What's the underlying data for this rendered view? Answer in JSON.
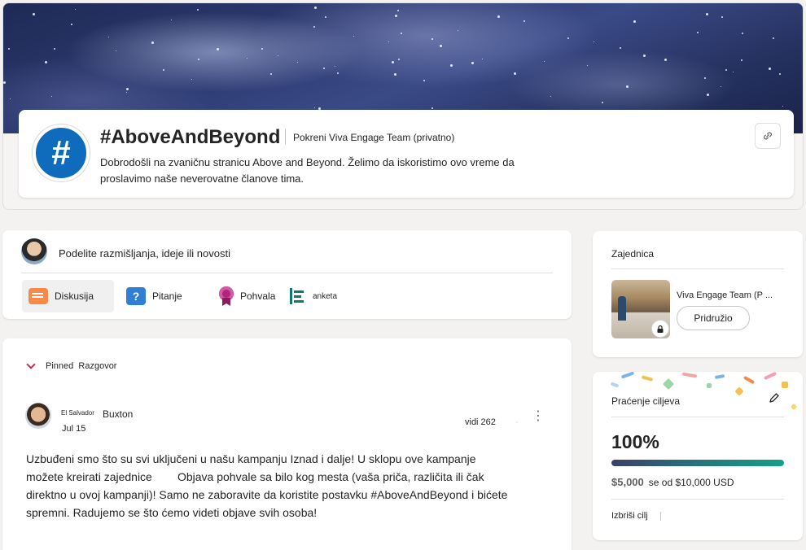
{
  "group": {
    "title": "#AboveAndBeyond",
    "subtitle": "Pokreni Viva Engage Team (privatno)",
    "description": "Dobrodošli na zvaničnu stranicu Above and Beyond. Želimo da iskoristimo ovo vreme da proslavimo naše neverovatne članove tima.",
    "avatar_glyph": "#",
    "link_icon": "link-icon",
    "accent": "#0f6cbd"
  },
  "composer": {
    "prompt": "Podelite razmišljanja, ideje ili novosti",
    "types": [
      {
        "label": "Diskusija",
        "icon": "discussion-icon"
      },
      {
        "label": "Pitanje",
        "icon": "question-icon"
      },
      {
        "label": "Pohvala",
        "icon": "praise-icon"
      },
      {
        "label": "anketa",
        "icon": "poll-icon"
      }
    ]
  },
  "feed": {
    "pinned_label": "Pinned",
    "conversation_label": "Razgovor",
    "post": {
      "author_prefix": "El Salvador",
      "author_name": "Buxton",
      "date": "Jul 15",
      "views": "vidi 262",
      "separator": "·",
      "more": "⋮",
      "body": "Uzbuđeni smo što su svi uključeni u našu kampanju Iznad i dalje! U sklopu ove kampanje možete kreirati zajednice        Objava pohvale sa bilo kog mesta (vaša priča, različita ili čak direktno u ovoj kampanji)! Samo ne zaboravite da koristite postavku #AboveAndBeyond i bićete spremni. Radujemo se što ćemo videti objave svih osoba!"
    }
  },
  "community": {
    "title": "Zajednica",
    "name": "Viva Engage Team (P ...",
    "joined_label": "Pridružio",
    "lock_icon": "lock-icon"
  },
  "goal": {
    "title": "Praćenje ciljeva",
    "percent": "100%",
    "progress": 1.0,
    "amount": "$5,000",
    "of_label": "se od $10,000 USD",
    "delete_label": "Izbriši cilj",
    "edit_icon": "pencil-icon",
    "bar_colors": [
      "#3d3d6b",
      "#16a085"
    ]
  }
}
